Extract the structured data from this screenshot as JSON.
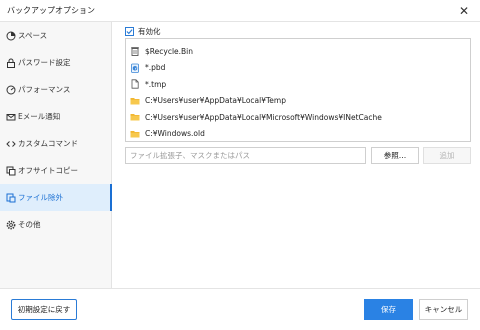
{
  "window": {
    "title": "バックアップオプション",
    "close_glyph": "✕"
  },
  "sidebar": {
    "items": [
      {
        "label": "スペース",
        "icon": "pie-chart-icon"
      },
      {
        "label": "パスワード設定",
        "icon": "lock-icon"
      },
      {
        "label": "パフォーマンス",
        "icon": "speedometer-icon"
      },
      {
        "label": "Eメール通知",
        "icon": "mail-icon"
      },
      {
        "label": "カスタムコマンド",
        "icon": "code-icon"
      },
      {
        "label": "オフサイトコピー",
        "icon": "copy-icon"
      },
      {
        "label": "ファイル除外",
        "icon": "file-exclude-icon",
        "active": true
      },
      {
        "label": "その他",
        "icon": "gear-icon"
      }
    ]
  },
  "exclusion": {
    "enable_label": "有効化",
    "enabled": true,
    "items": [
      {
        "text": "$Recycle.Bin",
        "icon": "recycle-bin-icon"
      },
      {
        "text": "*.pbd",
        "icon": "pbd-file-icon"
      },
      {
        "text": "*.tmp",
        "icon": "file-icon"
      },
      {
        "text": "C:¥Users¥user¥AppData¥Local¥Temp",
        "icon": "folder-icon"
      },
      {
        "text": "C:¥Users¥user¥AppData¥Local¥Microsoft¥Windows¥INetCache",
        "icon": "folder-icon"
      },
      {
        "text": "C:¥Windows.old",
        "icon": "folder-icon"
      }
    ],
    "input_placeholder": "ファイル拡張子、マスクまたはパス",
    "browse_label": "参照…",
    "add_label": "追加"
  },
  "footer": {
    "reset_label": "初期設定に戻す",
    "save_label": "保存",
    "cancel_label": "キャンセル"
  },
  "colors": {
    "accent": "#2a82e4",
    "active_bg": "#dfeefc",
    "folder": "#f2b731"
  }
}
